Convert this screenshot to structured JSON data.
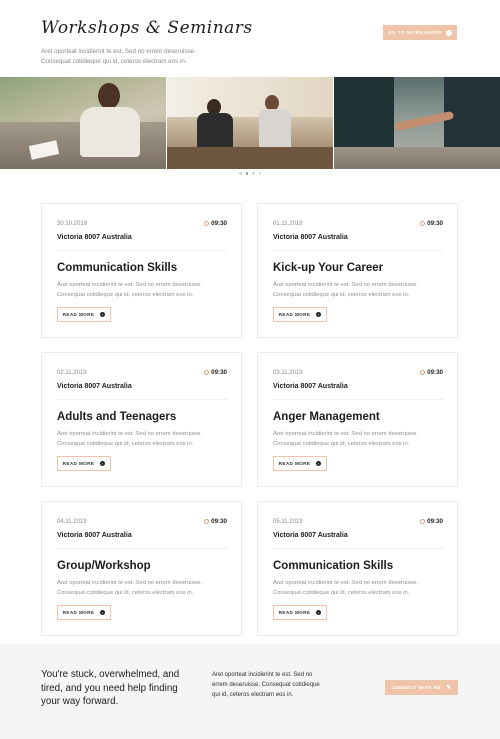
{
  "header": {
    "title": "Workshops & Seminars",
    "subtitle_line1": "Aret oporteat incidierint te est. Sed no errem deseruisse.",
    "subtitle_line2": "Consequat cotidieque qui id, ceteros electram eos in.",
    "button_label": "GO TO WORKSHOPS",
    "button_icon": "arrow-right-circle-icon"
  },
  "gallery": {
    "photos": [
      "man-reading-outdoors",
      "people-at-cafe-table",
      "holding-hands"
    ],
    "active_dot": 1,
    "dot_count": 4
  },
  "cards": [
    {
      "date": "30.10.2019",
      "time": "09:30",
      "location": "Victoria 8007 Australia",
      "title": "Communication Skills",
      "desc1": "Aret oporteat incidierint te est. Sed no errem deseruisse.",
      "desc2": "Consequat cotidieque qui id, ceteros electram eos in.",
      "button": "READ MORE"
    },
    {
      "date": "01.11.2019",
      "time": "09:30",
      "location": "Victoria 8007 Australia",
      "title": "Kick-up Your Career",
      "desc1": "Aret oporteat incidierint te est. Sed no errem deseruisse.",
      "desc2": "Consequat cotidieque qui id, ceteros electram eos in.",
      "button": "READ MORE"
    },
    {
      "date": "02.11.2019",
      "time": "09:30",
      "location": "Victoria 8007 Australia",
      "title": "Adults and Teenagers",
      "desc1": "Aret oporteat incidierint te est. Sed no errem deseruisse.",
      "desc2": "Consequat cotidieque qui id, ceteros electram eos in.",
      "button": "READ MORE"
    },
    {
      "date": "03.11.2019",
      "time": "09:30",
      "location": "Victoria 8007 Australia",
      "title": "Anger Management",
      "desc1": "Aret oporteat incidierint te est. Sed no errem deseruisse.",
      "desc2": "Consequat cotidieque qui id, ceteros electram eos in.",
      "button": "READ MORE"
    },
    {
      "date": "04.11.2019",
      "time": "09:30",
      "location": "Victoria 8007 Australia",
      "title": "Group/Workshop",
      "desc1": "Aret oporteat incidierint te est. Sed no errem deseruisse.",
      "desc2": "Consequat cotidieque qui id, ceteros electram eos in.",
      "button": "READ MORE"
    },
    {
      "date": "05.11.2019",
      "time": "09:30",
      "location": "Victoria 8007 Australia",
      "title": "Communication Skills",
      "desc1": "Aret oporteat incidierint te est. Sed no errem deseruisse.",
      "desc2": "Consequat cotidieque qui id, ceteros electram eos in.",
      "button": "READ MORE"
    }
  ],
  "cta": {
    "heading_line1": "You're stuck, overwhelmed, and",
    "heading_line2": "tired, and you need help finding",
    "heading_line3": "your way forward.",
    "text_line1": "Aret oporteat incidierint te est. Sed no",
    "text_line2": "errem deseruisse. Consequat cotidieque",
    "text_line3": "qui id, ceteros electram eos in.",
    "button_label": "CONNECT WITH ME",
    "button_icon": "pencil-icon"
  },
  "colors": {
    "accent": "#f0c4a8",
    "text_dark": "#1d1d1d",
    "text_muted": "#8f8f8f",
    "cta_bg": "#f5f5f5"
  }
}
